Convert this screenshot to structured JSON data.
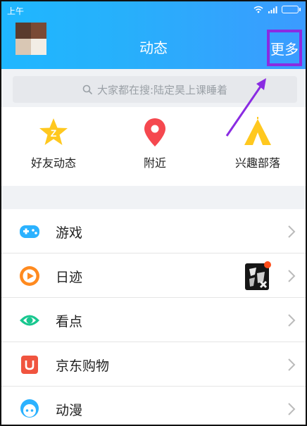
{
  "status": {
    "time": "上午"
  },
  "header": {
    "title": "动态",
    "more_label": "更多"
  },
  "search": {
    "placeholder": "大家都在搜:陆定昊上课睡着"
  },
  "quick_actions": [
    {
      "label": "好友动态",
      "icon": "friends-feed-icon",
      "color": "#ffc81f"
    },
    {
      "label": "附近",
      "icon": "location-pin-icon",
      "color": "#f5484f"
    },
    {
      "label": "兴趣部落",
      "icon": "tent-icon",
      "color": "#ffc81f"
    }
  ],
  "list": [
    {
      "label": "游戏",
      "icon": "gamepad-icon",
      "color": "#2bb2ff"
    },
    {
      "label": "日迹",
      "icon": "play-circle-icon",
      "color": "#ff8a1f"
    },
    {
      "label": "看点",
      "icon": "eye-icon",
      "color": "#18c78f"
    },
    {
      "label": "京东购物",
      "icon": "jd-shop-icon",
      "color": "#f0543f"
    },
    {
      "label": "动漫",
      "icon": "anime-icon",
      "color": "#2bb2ff"
    }
  ],
  "colors": {
    "header_start": "#1fb7ff",
    "header_end": "#3b9bff",
    "highlight": "#8a2be2"
  }
}
